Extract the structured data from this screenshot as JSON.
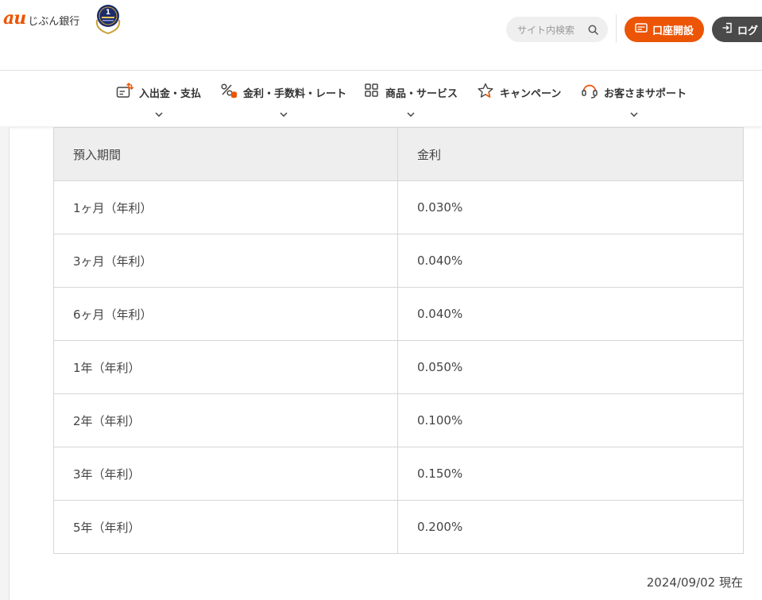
{
  "header": {
    "logo_au": "au",
    "logo_name": "じぶん銀行",
    "search_placeholder": "サイト内検索",
    "open_account_label": "口座開設",
    "login_label": "ログ"
  },
  "nav": {
    "items": [
      {
        "label": "入出金・支払",
        "icon": "deposit-withdraw-icon"
      },
      {
        "label": "金利・手数料・レート",
        "icon": "percent-icon"
      },
      {
        "label": "商品・サービス",
        "icon": "grid-icon"
      },
      {
        "label": "キャンペーン",
        "icon": "star-icon"
      },
      {
        "label": "お客さまサポート",
        "icon": "support-headset-icon"
      }
    ]
  },
  "rate_table": {
    "headers": [
      "預入期間",
      "金利"
    ],
    "rows": [
      {
        "term": "1ヶ月（年利）",
        "rate": "0.030%"
      },
      {
        "term": "3ヶ月（年利）",
        "rate": "0.040%"
      },
      {
        "term": "6ヶ月（年利）",
        "rate": "0.040%"
      },
      {
        "term": "1年（年利）",
        "rate": "0.050%"
      },
      {
        "term": "2年（年利）",
        "rate": "0.100%"
      },
      {
        "term": "3年（年利）",
        "rate": "0.150%"
      },
      {
        "term": "5年（年利）",
        "rate": "0.200%"
      }
    ]
  },
  "as_of": "2024/09/02 現在",
  "colors": {
    "brand_orange": "#eb5505",
    "login_dark": "#4a4a4a",
    "table_header_bg": "#eeeeee"
  }
}
